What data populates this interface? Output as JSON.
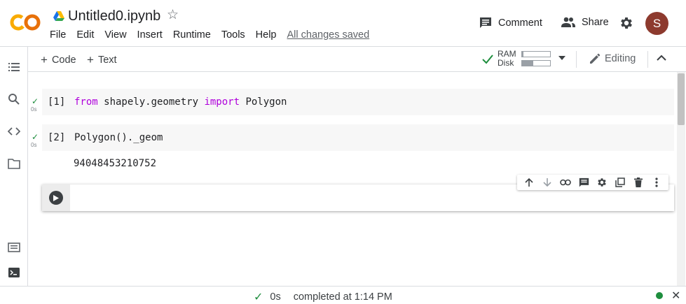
{
  "header": {
    "file_name": "Untitled0.ipynb",
    "menu": [
      "File",
      "Edit",
      "View",
      "Insert",
      "Runtime",
      "Tools",
      "Help"
    ],
    "save_status": "All changes saved",
    "comment_label": "Comment",
    "share_label": "Share",
    "avatar_letter": "S",
    "avatar_color": "#8d3a2e",
    "logo_text": "CO"
  },
  "toolbar": {
    "add_code_label": "Code",
    "add_text_label": "Text",
    "ram_label": "RAM",
    "disk_label": "Disk",
    "ram_usage": 0.05,
    "disk_usage": 0.4,
    "editing_label": "Editing"
  },
  "cells": [
    {
      "prompt": "[1]",
      "exec_time": "0s",
      "code_tokens": [
        {
          "text": "from",
          "kw": true
        },
        {
          "text": " shapely.geometry ",
          "kw": false
        },
        {
          "text": "import",
          "kw": true
        },
        {
          "text": " Polygon",
          "kw": false
        }
      ]
    },
    {
      "prompt": "[2]",
      "exec_time": "0s",
      "code": "Polygon()._geom",
      "output": "94048453210752"
    }
  ],
  "status": {
    "duration": "0s",
    "message": "completed at 1:14 PM",
    "connected_color": "#1e8e3e"
  },
  "colors": {
    "keyword": "#af00db",
    "success": "#1e8e3e",
    "logo_orange": "#f9ab00",
    "logo_dark": "#e8710a"
  }
}
